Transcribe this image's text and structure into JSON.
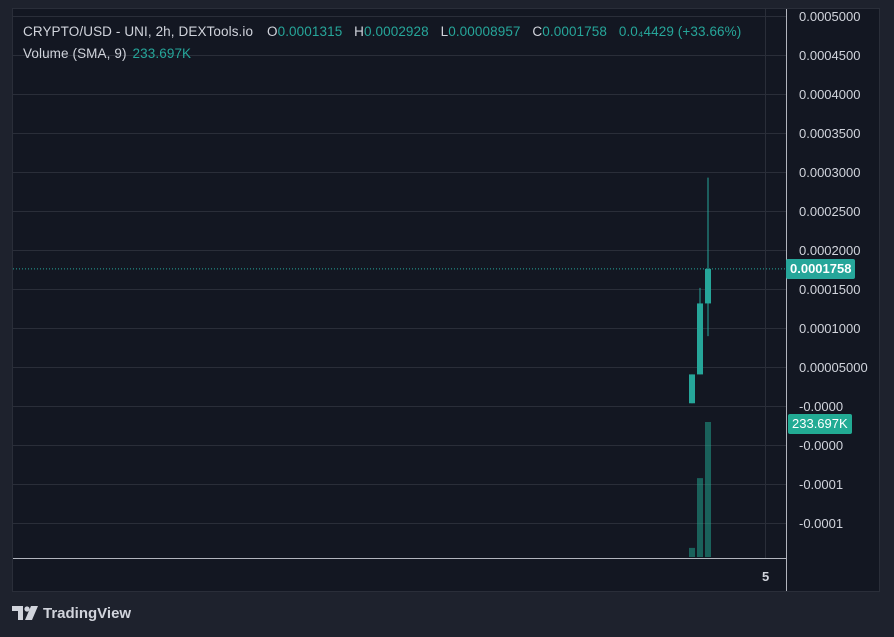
{
  "legend": {
    "title": "CRYPTO/USD - UNI, 2h, DEXTools.io",
    "o_label": "O",
    "o_value": "0.0001315",
    "h_label": "H",
    "h_value": "0.0002928",
    "l_label": "L",
    "l_value": "0.00008957",
    "c_label": "C",
    "c_value": "0.0001758",
    "change": "0.0₄4429 (+33.66%)",
    "volume_label": "Volume (SMA, 9)",
    "volume_value": "233.697K"
  },
  "price_axis": {
    "ticks": [
      "0.0005000",
      "0.0004500",
      "0.0004000",
      "0.0003500",
      "0.0003000",
      "0.0002500",
      "0.0002000",
      "0.0001500",
      "0.0001000",
      "0.00005000",
      "-0.0000",
      "-0.0000",
      "-0.0001",
      "-0.0001"
    ],
    "current_price_tag": "0.0001758",
    "volume_tag": "233.697K"
  },
  "time_axis": {
    "ticks": [
      "5"
    ]
  },
  "colors": {
    "up": "#26a69a",
    "volume_up": "#22ab94",
    "background": "#131722",
    "grid": "#2a2e39",
    "text": "#d1d4dc"
  },
  "chart_data": {
    "type": "candlestick",
    "price_ylim": [
      -0.00015,
      0.0005
    ],
    "candles": [
      {
        "open": 3.5e-06,
        "high": 4.05e-05,
        "low": 3.5e-06,
        "close": 4.05e-05
      },
      {
        "open": 4.05e-05,
        "high": 0.0001515,
        "low": 4.05e-05,
        "close": 0.0001315
      },
      {
        "open": 0.0001315,
        "high": 0.0002928,
        "low": 8.957e-05,
        "close": 0.0001758
      }
    ],
    "volume": [
      30000,
      260000,
      445000
    ],
    "volume_sma_last": "233.697K",
    "last_close": 0.0001758
  },
  "watermark": {
    "text": "TradingView"
  }
}
